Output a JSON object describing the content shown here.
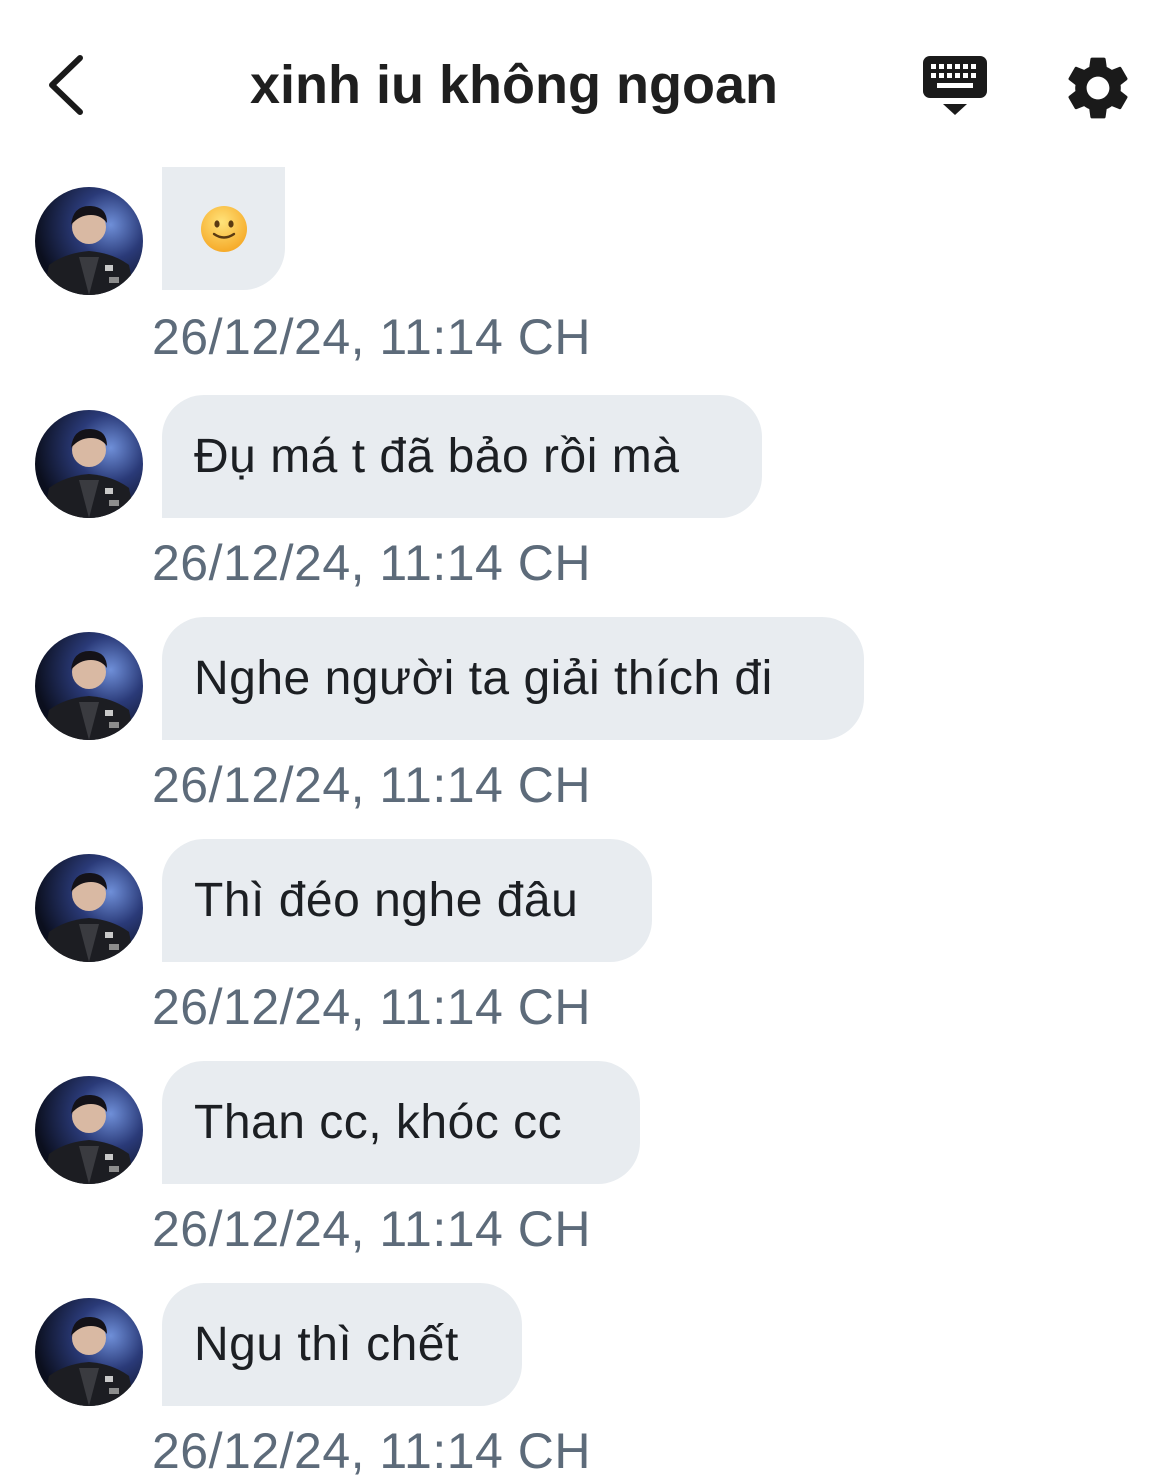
{
  "header": {
    "title": "xinh iu không ngoan",
    "back_icon": "chevron-left-icon",
    "keyboard_icon": "keyboard-icon",
    "settings_icon": "gear-icon"
  },
  "colors": {
    "bubble_bg": "#e8ecf0",
    "timestamp": "#5d6b7a",
    "text": "#1c1f23"
  },
  "messages": [
    {
      "text": "",
      "emoji": "slightly-smiling-face-icon",
      "time": "26/12/24, 11:14 CH"
    },
    {
      "text": "Đụ má t đã bảo rồi mà",
      "time": "26/12/24, 11:14 CH"
    },
    {
      "text": "Nghe người ta giải thích đi",
      "time": "26/12/24, 11:14 CH"
    },
    {
      "text": "Thì đéo nghe đâu",
      "time": "26/12/24, 11:14 CH"
    },
    {
      "text": "Than cc, khóc cc",
      "time": "26/12/24, 11:14 CH"
    },
    {
      "text": "Ngu thì chết",
      "time": "26/12/24, 11:14 CH"
    }
  ]
}
